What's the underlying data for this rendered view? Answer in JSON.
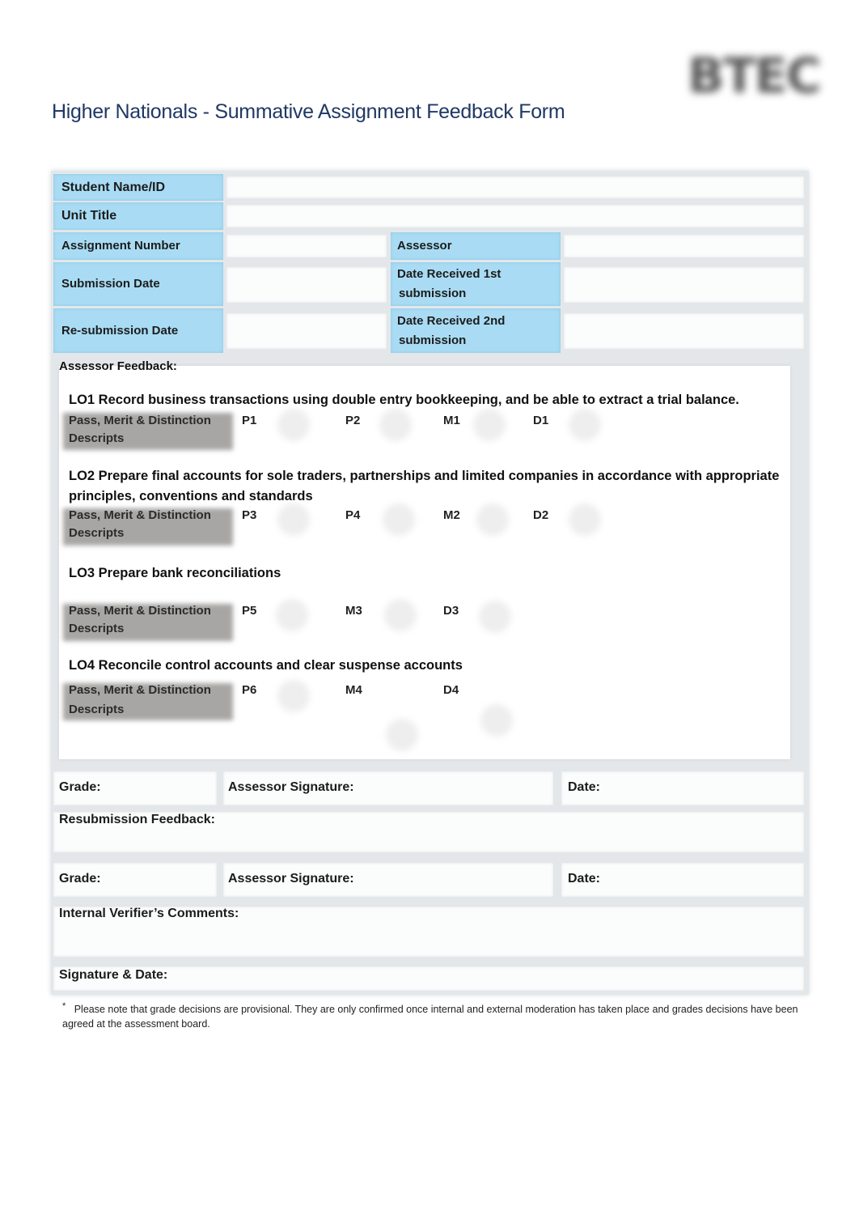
{
  "header": {
    "logo_text": "BTEC",
    "title": "Higher Nationals - Summative Assignment Feedback Form"
  },
  "details": {
    "student_name_label": "Student Name/ID",
    "student_name_value": "",
    "unit_title_label": "Unit Title",
    "unit_title_value": "",
    "assignment_number_label": "Assignment  Number",
    "assignment_number_value": "",
    "assessor_label": "Assessor",
    "assessor_value": "",
    "submission_date_label": "Submission Date",
    "submission_date_value": "",
    "date_received_1_label_line1": "Date Received 1st",
    "date_received_1_label_line2": "submission",
    "date_received_1_value": "",
    "resubmission_date_label": "Re-submission Date",
    "resubmission_date_value": "",
    "date_received_2_label_line1": "Date Received 2nd",
    "date_received_2_label_line2": "submission",
    "date_received_2_value": ""
  },
  "feedback": {
    "label": "Assessor  Feedback:",
    "descripts_line1": "Pass, Merit & Distinction",
    "descripts_line2": "Descripts",
    "outcomes": [
      {
        "title": "LO1 Record business transactions using double entry bookkeeping, and be able to extract a trial balance.",
        "criteria": [
          "P1",
          "P2",
          "M1",
          "D1"
        ]
      },
      {
        "title": "LO2 Prepare final accounts for sole traders, partnerships and limited companies in accordance with appropriate principles, conventions and standards",
        "criteria": [
          "P3",
          "P4",
          "M2",
          "D2"
        ]
      },
      {
        "title": "LO3 Prepare bank reconciliations",
        "criteria": [
          "P5",
          "M3",
          "D3"
        ]
      },
      {
        "title": "LO4 Reconcile control accounts and clear suspense accounts",
        "criteria": [
          "P6",
          "M4",
          "D4"
        ]
      }
    ]
  },
  "grading": {
    "grade_label": "Grade:",
    "assessor_signature_label": "Assessor Signature:",
    "date_label": "Date:",
    "resubmission_feedback_label": "Resubmission Feedback:",
    "internal_verifier_label": "Internal Verifier’s Comments:",
    "signature_date_label": "Signature & Date:"
  },
  "footnote": {
    "marker": "*",
    "text": "Please note that grade decisions are provisional. They are only confirmed once internal and external moderation has taken place and grades decisions have been agreed at the assessment board."
  }
}
